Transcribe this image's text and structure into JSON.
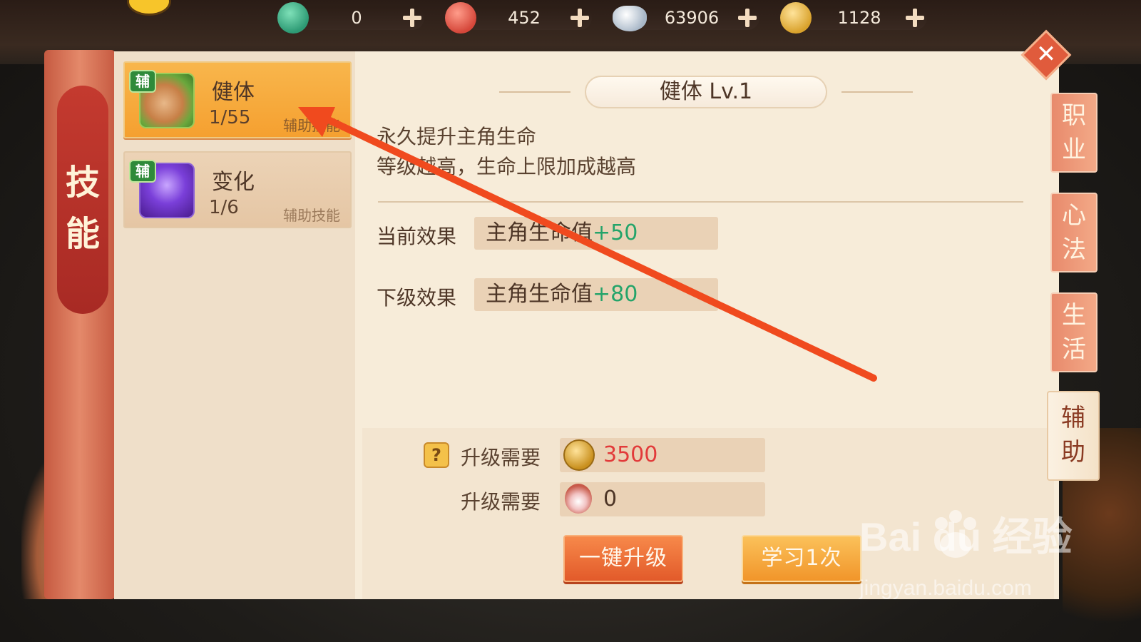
{
  "currencies": [
    {
      "icon": "jade-dragon-coin-icon",
      "value": "0"
    },
    {
      "icon": "red-dragon-coin-icon",
      "value": "452"
    },
    {
      "icon": "silver-ingot-icon",
      "value": "63906"
    },
    {
      "icon": "gold-coin-icon",
      "value": "1128"
    }
  ],
  "side_title": "技能",
  "skills": [
    {
      "tag": "辅",
      "name": "健体",
      "level": "1/55",
      "type": "辅助技能",
      "icon": "bear-skill-icon"
    },
    {
      "tag": "辅",
      "name": "变化",
      "level": "1/6",
      "type": "辅助技能",
      "icon": "shadow-skill-icon"
    }
  ],
  "detail": {
    "title": "健体 Lv.1",
    "desc_line1": "永久提升主角生命",
    "desc_line2": "等级越高，生命上限加成越高",
    "current_label": "当前效果",
    "current_stat": "主角生命值",
    "current_bonus": "+50",
    "next_label": "下级效果",
    "next_stat": "主角生命值",
    "next_bonus": "+80"
  },
  "requirements": {
    "help": "?",
    "label1": "升级需要",
    "value1": "3500",
    "label2": "升级需要",
    "value2": "0"
  },
  "buttons": {
    "upgrade_all": "一键升级",
    "learn_once": "学习1次"
  },
  "tabs": [
    {
      "line1": "职",
      "line2": "业"
    },
    {
      "line1": "心",
      "line2": "法"
    },
    {
      "line1": "生",
      "line2": "活"
    },
    {
      "line1": "辅",
      "line2": "助"
    }
  ],
  "watermark": {
    "brand": "Bai du 经验",
    "url": "jingyan.baidu.com"
  },
  "colors": {
    "accent_orange": "#f5a030",
    "bonus_green": "#24a46a",
    "cost_red": "#e23a3a",
    "arrow_red": "#f04a1e"
  }
}
